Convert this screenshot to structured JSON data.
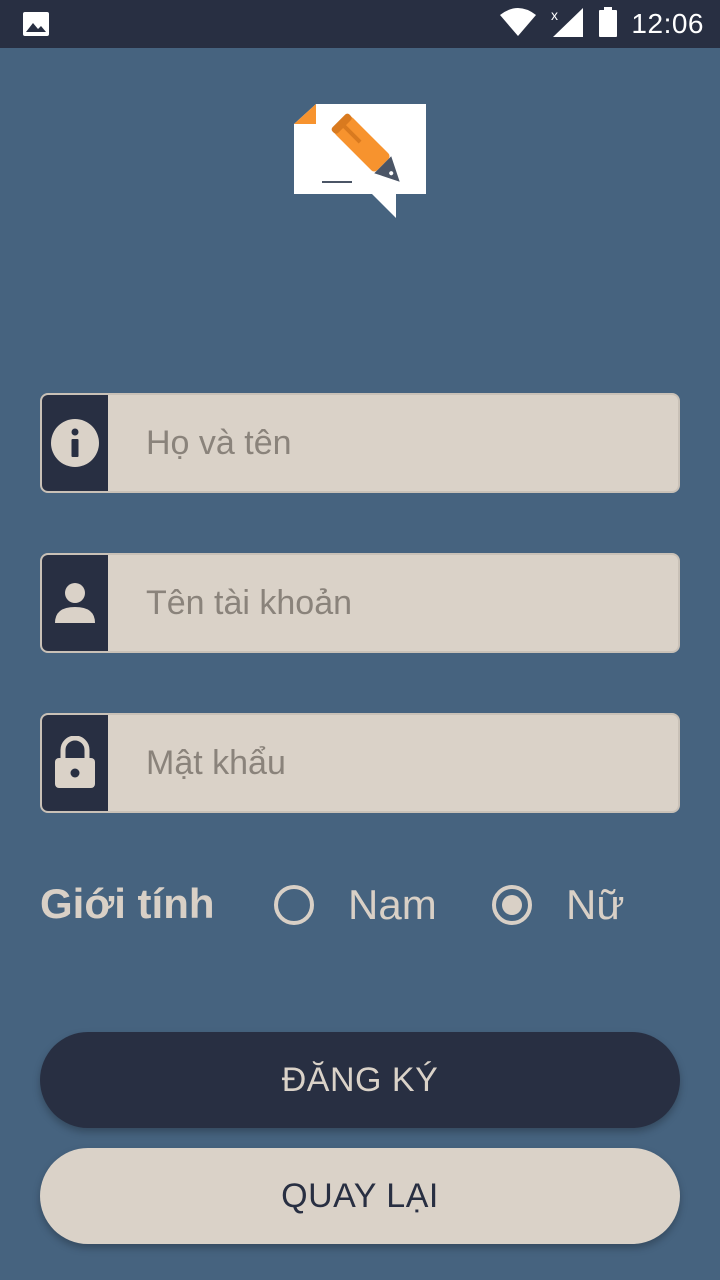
{
  "status_bar": {
    "time": "12:06",
    "left_icon": "image-icon",
    "icons": [
      "wifi-icon",
      "signal-icon",
      "battery-icon"
    ]
  },
  "logo": {
    "icon": "pen-speech-bubble-logo"
  },
  "form": {
    "full_name": {
      "placeholder": "Họ và tên",
      "icon": "info-icon"
    },
    "username": {
      "placeholder": "Tên tài khoản",
      "icon": "person-icon"
    },
    "password": {
      "placeholder": "Mật khẩu",
      "icon": "lock-icon"
    }
  },
  "gender": {
    "label": "Giới tính",
    "options": [
      {
        "label": "Nam",
        "selected": false
      },
      {
        "label": "Nữ",
        "selected": true
      }
    ]
  },
  "buttons": {
    "register_label": "ĐĂNG KÝ",
    "back_label": "QUAY LẠI"
  },
  "colors": {
    "background": "#46637f",
    "dark": "#282f42",
    "light": "#dad2c8",
    "accent_orange": "#f7932e"
  }
}
